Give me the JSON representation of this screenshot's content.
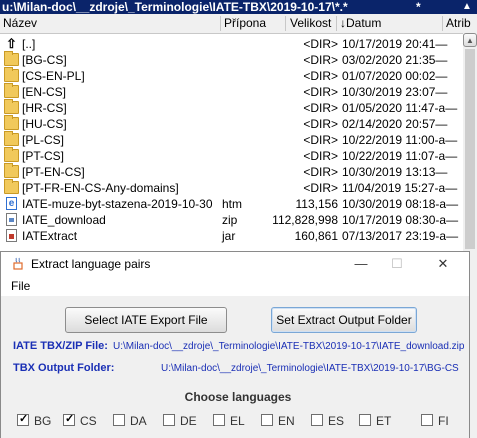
{
  "path_bar": {
    "text": "u:\\Milan-doc\\__zdroje\\_Terminologie\\IATE-TBX\\2019-10-17\\*.*",
    "star": "*",
    "arrow": "▲"
  },
  "columns": {
    "name": "Název",
    "ext": "Přípona",
    "size": "Velikost",
    "date": "↓Datum",
    "attr": "Atrib"
  },
  "files": [
    {
      "icon": "up-dir-icon",
      "name": "[..]",
      "ext": "",
      "size": "<DIR>",
      "date": "10/17/2019 20:41—"
    },
    {
      "icon": "folder-icon",
      "name": "[BG-CS]",
      "ext": "",
      "size": "<DIR>",
      "date": "03/02/2020 21:35—"
    },
    {
      "icon": "folder-icon",
      "name": "[CS-EN-PL]",
      "ext": "",
      "size": "<DIR>",
      "date": "01/07/2020 00:02—"
    },
    {
      "icon": "folder-icon",
      "name": "[EN-CS]",
      "ext": "",
      "size": "<DIR>",
      "date": "10/30/2019 23:07—"
    },
    {
      "icon": "folder-icon",
      "name": "[HR-CS]",
      "ext": "",
      "size": "<DIR>",
      "date": "01/05/2020 11:47-a—"
    },
    {
      "icon": "folder-icon",
      "name": "[HU-CS]",
      "ext": "",
      "size": "<DIR>",
      "date": "02/14/2020 20:57—"
    },
    {
      "icon": "folder-icon",
      "name": "[PL-CS]",
      "ext": "",
      "size": "<DIR>",
      "date": "10/22/2019 11:00-a—"
    },
    {
      "icon": "folder-icon",
      "name": "[PT-CS]",
      "ext": "",
      "size": "<DIR>",
      "date": "10/22/2019 11:07-a—"
    },
    {
      "icon": "folder-icon",
      "name": "[PT-EN-CS]",
      "ext": "",
      "size": "<DIR>",
      "date": "10/30/2019 13:13—"
    },
    {
      "icon": "folder-icon",
      "name": "[PT-FR-EN-CS-Any-domains]",
      "ext": "",
      "size": "<DIR>",
      "date": "11/04/2019 15:27-a—"
    },
    {
      "icon": "html-file-icon",
      "name": "IATE-muze-byt-stazena-2019-10-30",
      "ext": "htm",
      "size": "113,156",
      "date": "10/30/2019 08:18-a—"
    },
    {
      "icon": "zip-file-icon",
      "name": "IATE_download",
      "ext": "zip",
      "size": "112,828,998",
      "date": "10/17/2019 08:30-a—"
    },
    {
      "icon": "jar-file-icon",
      "name": "IATExtract",
      "ext": "jar",
      "size": "160,861",
      "date": "07/13/2017 23:19-a—"
    }
  ],
  "dialog": {
    "title": "Extract language pairs",
    "controls": {
      "minimize": "—",
      "maximize": "☐",
      "close": "✕"
    },
    "menu_file": "File",
    "select_export_button": "Select IATE Export File",
    "set_output_button": "Set Extract Output Folder",
    "iate_label": "IATE TBX/ZIP File:",
    "iate_value": "U:\\Milan-doc\\__zdroje\\_Terminologie\\IATE-TBX\\2019-10-17\\IATE_download.zip",
    "tbx_label": "TBX Output Folder:",
    "tbx_value": "U:\\Milan-doc\\__zdroje\\_Terminologie\\IATE-TBX\\2019-10-17\\BG-CS",
    "choose_languages": "Choose languages",
    "languages": [
      {
        "code": "BG",
        "checked": true
      },
      {
        "code": "CS",
        "checked": true
      },
      {
        "code": "DA",
        "checked": false
      },
      {
        "code": "DE",
        "checked": false
      },
      {
        "code": "EL",
        "checked": false
      },
      {
        "code": "EN",
        "checked": false
      },
      {
        "code": "ES",
        "checked": false
      },
      {
        "code": "ET",
        "checked": false
      },
      {
        "code": "FI",
        "checked": false
      }
    ]
  }
}
